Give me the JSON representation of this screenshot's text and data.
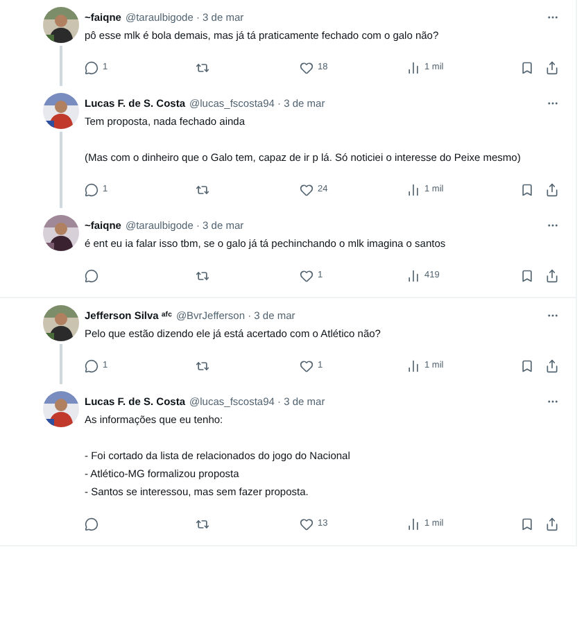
{
  "threads": [
    {
      "tweets": [
        {
          "name": "~faiqne",
          "handle_date": "@taraulbigode · 3 de mar",
          "paragraphs": [
            [
              "pô esse mlk é bola demais, mas já tá praticamente fechado com o galo não?"
            ]
          ],
          "replies": "1",
          "likes": "18",
          "views": "1 mil"
        },
        {
          "name": "Lucas F. de S. Costa",
          "handle_date": "@lucas_fscosta94 · 3 de mar",
          "paragraphs": [
            [
              "Tem proposta, nada fechado ainda"
            ],
            [
              "(Mas com o dinheiro que o Galo tem, capaz de ir p lá. Só noticiei o interesse do Peixe mesmo)"
            ]
          ],
          "replies": "1",
          "likes": "24",
          "views": "1 mil"
        },
        {
          "name": "~faiqne",
          "handle_date": "@taraulbigode · 3 de mar",
          "paragraphs": [
            [
              "é ent eu ia falar isso tbm, se o galo já tá pechinchando o mlk imagina o santos"
            ]
          ],
          "likes": "1",
          "views": "419"
        }
      ]
    },
    {
      "tweets": [
        {
          "name": "Jefferson Silva ᵃᶠᶜ",
          "handle_date": "@BvrJefferson · 3 de mar",
          "paragraphs": [
            [
              "Pelo que estão dizendo ele já está acertado com o Atlético não?"
            ]
          ],
          "replies": "1",
          "likes": "1",
          "views": "1 mil"
        },
        {
          "name": "Lucas F. de S. Costa",
          "handle_date": "@lucas_fscosta94 · 3 de mar",
          "paragraphs": [
            [
              "As informações que eu tenho:"
            ],
            [
              "- Foi cortado da lista de relacionados do jogo do Nacional",
              "- Atlético-MG formalizou proposta",
              "- Santos se interessou, mas sem fazer proposta."
            ]
          ],
          "likes": "13",
          "views": "1 mil"
        }
      ]
    }
  ]
}
